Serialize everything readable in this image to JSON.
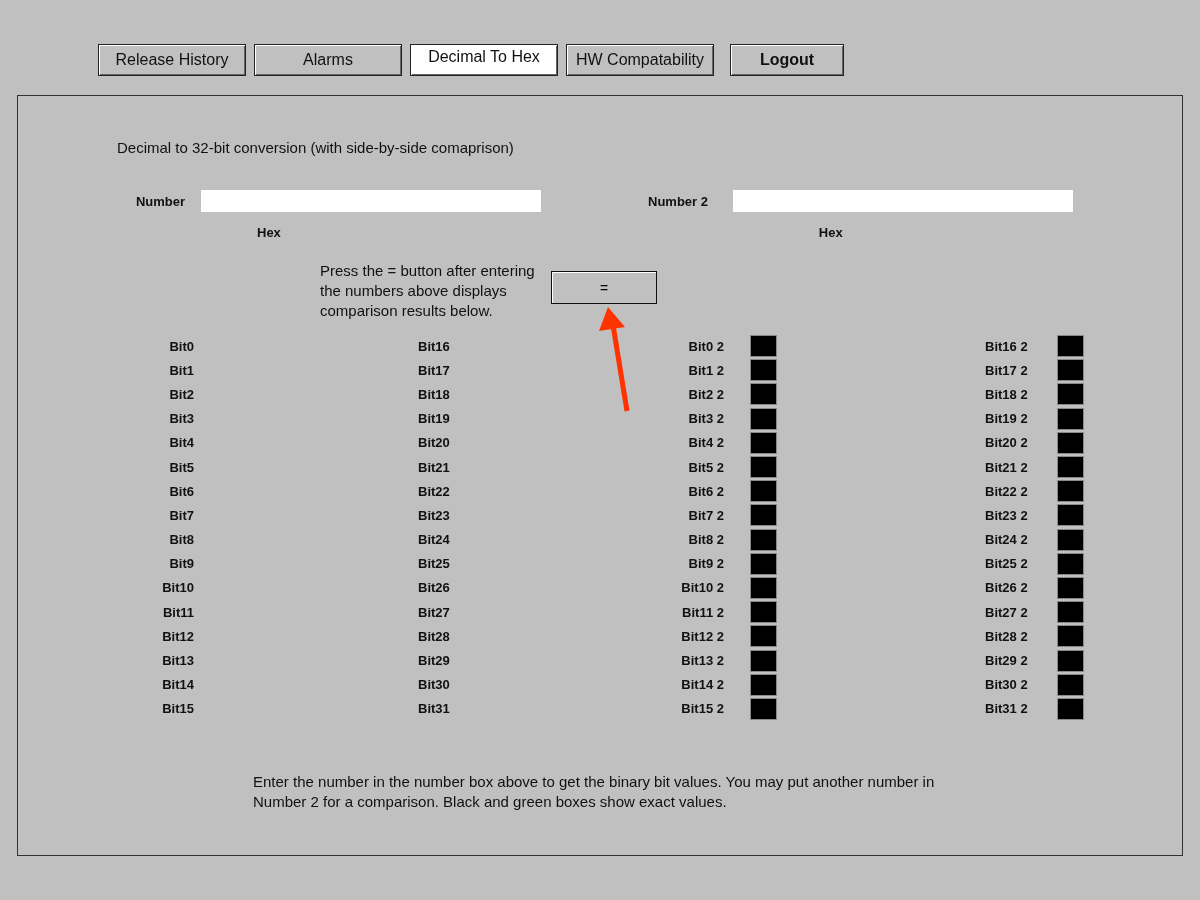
{
  "tabs": [
    {
      "label": "Release History",
      "selected": false
    },
    {
      "label": "Alarms",
      "selected": false
    },
    {
      "label": "Decimal To Hex",
      "selected": true
    },
    {
      "label": "HW Compatability",
      "selected": false
    }
  ],
  "logout_button": "Logout",
  "title": "Decimal to 32-bit conversion (with side-by-side comaprison)",
  "number_field": {
    "label": "Number",
    "hex_label": "Hex"
  },
  "number2_field": {
    "label": "Number 2",
    "hex_label": "Hex"
  },
  "instruction": "Press the = button after entering the numbers above displays comparison results below.",
  "equals_button": "=",
  "bits_1_low": [
    "Bit0",
    "Bit1",
    "Bit2",
    "Bit3",
    "Bit4",
    "Bit5",
    "Bit6",
    "Bit7",
    "Bit8",
    "Bit9",
    "Bit10",
    "Bit11",
    "Bit12",
    "Bit13",
    "Bit14",
    "Bit15"
  ],
  "bits_1_high": [
    "Bit16",
    "Bit17",
    "Bit18",
    "Bit19",
    "Bit20",
    "Bit21",
    "Bit22",
    "Bit23",
    "Bit24",
    "Bit25",
    "Bit26",
    "Bit27",
    "Bit28",
    "Bit29",
    "Bit30",
    "Bit31"
  ],
  "bits_2_low": [
    {
      "label": "Bit0 2",
      "on": false
    },
    {
      "label": "Bit1 2",
      "on": false
    },
    {
      "label": "Bit2 2",
      "on": false
    },
    {
      "label": "Bit3 2",
      "on": false
    },
    {
      "label": "Bit4 2",
      "on": false
    },
    {
      "label": "Bit5 2",
      "on": false
    },
    {
      "label": "Bit6 2",
      "on": false
    },
    {
      "label": "Bit7 2",
      "on": false
    },
    {
      "label": "Bit8 2",
      "on": false
    },
    {
      "label": "Bit9 2",
      "on": false
    },
    {
      "label": "Bit10 2",
      "on": false
    },
    {
      "label": "Bit11 2",
      "on": false
    },
    {
      "label": "Bit12 2",
      "on": false
    },
    {
      "label": "Bit13 2",
      "on": false
    },
    {
      "label": "Bit14 2",
      "on": false
    },
    {
      "label": "Bit15 2",
      "on": false
    }
  ],
  "bits_2_high": [
    {
      "label": "Bit16 2",
      "on": false
    },
    {
      "label": "Bit17 2",
      "on": false
    },
    {
      "label": "Bit18 2",
      "on": false
    },
    {
      "label": "Bit19 2",
      "on": false
    },
    {
      "label": "Bit20 2",
      "on": false
    },
    {
      "label": "Bit21 2",
      "on": false
    },
    {
      "label": "Bit22 2",
      "on": false
    },
    {
      "label": "Bit23 2",
      "on": false
    },
    {
      "label": "Bit24 2",
      "on": false
    },
    {
      "label": "Bit25 2",
      "on": false
    },
    {
      "label": "Bit26 2",
      "on": false
    },
    {
      "label": "Bit27 2",
      "on": false
    },
    {
      "label": "Bit28 2",
      "on": false
    },
    {
      "label": "Bit29 2",
      "on": false
    },
    {
      "label": "Bit30 2",
      "on": false
    },
    {
      "label": "Bit31 2",
      "on": false
    }
  ],
  "footer_note": "Enter the number in the number box above to get the binary bit values.  You may put another number in Number 2 for a comparison.  Black and green boxes show exact values."
}
